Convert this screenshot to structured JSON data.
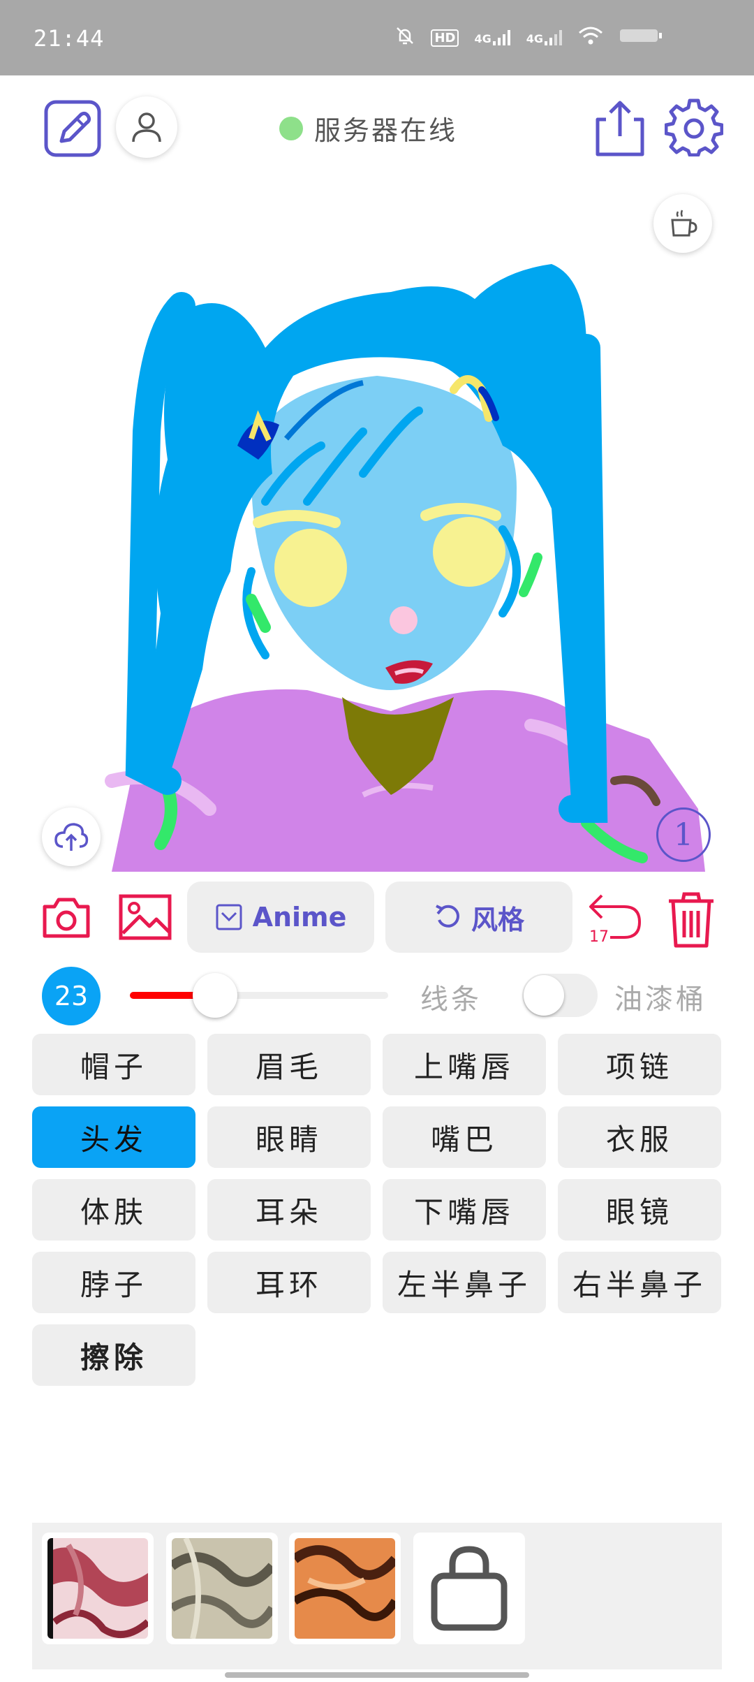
{
  "status_bar": {
    "time": "21:44",
    "hd_label": "HD",
    "network_1": "4G",
    "network_2": "4G",
    "icons": [
      "alarm-off-icon",
      "hd-icon",
      "signal-icon",
      "signal-icon",
      "wifi-icon",
      "battery-icon"
    ]
  },
  "header": {
    "server_status": "服务器在线",
    "server_status_color": "#8ee08a",
    "accent_color": "#5b55c9"
  },
  "canvas": {
    "layer_number": "1"
  },
  "tools": {
    "anime_label": "Anime",
    "style_label": "风格",
    "undo_count": "17",
    "danger_color": "#e8194f"
  },
  "brush": {
    "size": "23",
    "size_slider_fraction": 0.33,
    "line_label": "线条",
    "bucket_label": "油漆桶",
    "bucket_enabled": false,
    "slider_color": "#ff0000"
  },
  "categories": [
    {
      "label": "帽子",
      "active": false
    },
    {
      "label": "眉毛",
      "active": false
    },
    {
      "label": "上嘴唇",
      "active": false
    },
    {
      "label": "项链",
      "active": false
    },
    {
      "label": "头发",
      "active": true
    },
    {
      "label": "眼睛",
      "active": false
    },
    {
      "label": "嘴巴",
      "active": false
    },
    {
      "label": "衣服",
      "active": false
    },
    {
      "label": "体肤",
      "active": false
    },
    {
      "label": "耳朵",
      "active": false
    },
    {
      "label": "下嘴唇",
      "active": false
    },
    {
      "label": "眼镜",
      "active": false
    },
    {
      "label": "脖子",
      "active": false
    },
    {
      "label": "耳环",
      "active": false
    },
    {
      "label": "左半鼻子",
      "active": false
    },
    {
      "label": "右半鼻子",
      "active": false
    },
    {
      "label": "擦除",
      "active": false
    }
  ],
  "active_color": "#0aa3f5"
}
